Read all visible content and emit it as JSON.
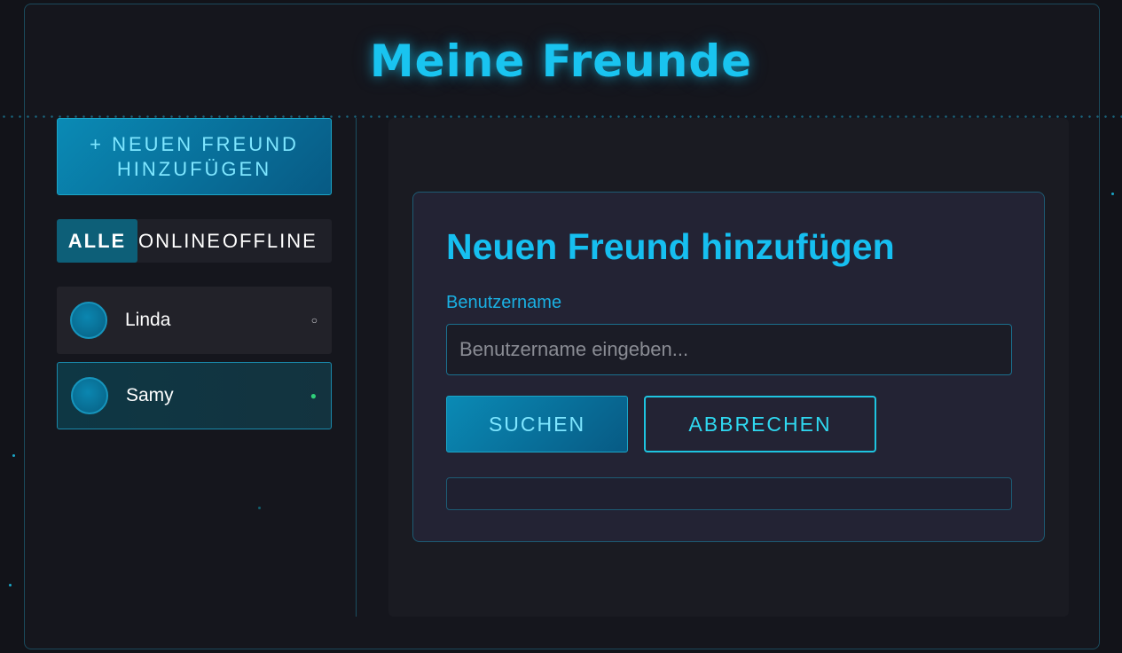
{
  "page": {
    "title": "Meine Freunde"
  },
  "sidebar": {
    "add_friend_label": "+ NEUEN FREUND HINZUFÜGEN",
    "filters": [
      {
        "label": "ALLE",
        "active": true
      },
      {
        "label": "ONLINE",
        "active": false
      },
      {
        "label": "OFFLINE",
        "active": false
      }
    ],
    "friends": [
      {
        "name": "Linda",
        "status": "offline",
        "status_glyph": "○"
      },
      {
        "name": "Samy",
        "status": "online",
        "status_glyph": "●"
      }
    ]
  },
  "dialog": {
    "title": "Neuen Freund hinzufügen",
    "username_label": "Benutzername",
    "username_value": "",
    "username_placeholder": "Benutzername eingeben...",
    "search_label": "SUCHEN",
    "cancel_label": "ABBRECHEN"
  },
  "colors": {
    "accent": "#19c4f0",
    "online": "#2fd07a",
    "background": "#15161d"
  }
}
